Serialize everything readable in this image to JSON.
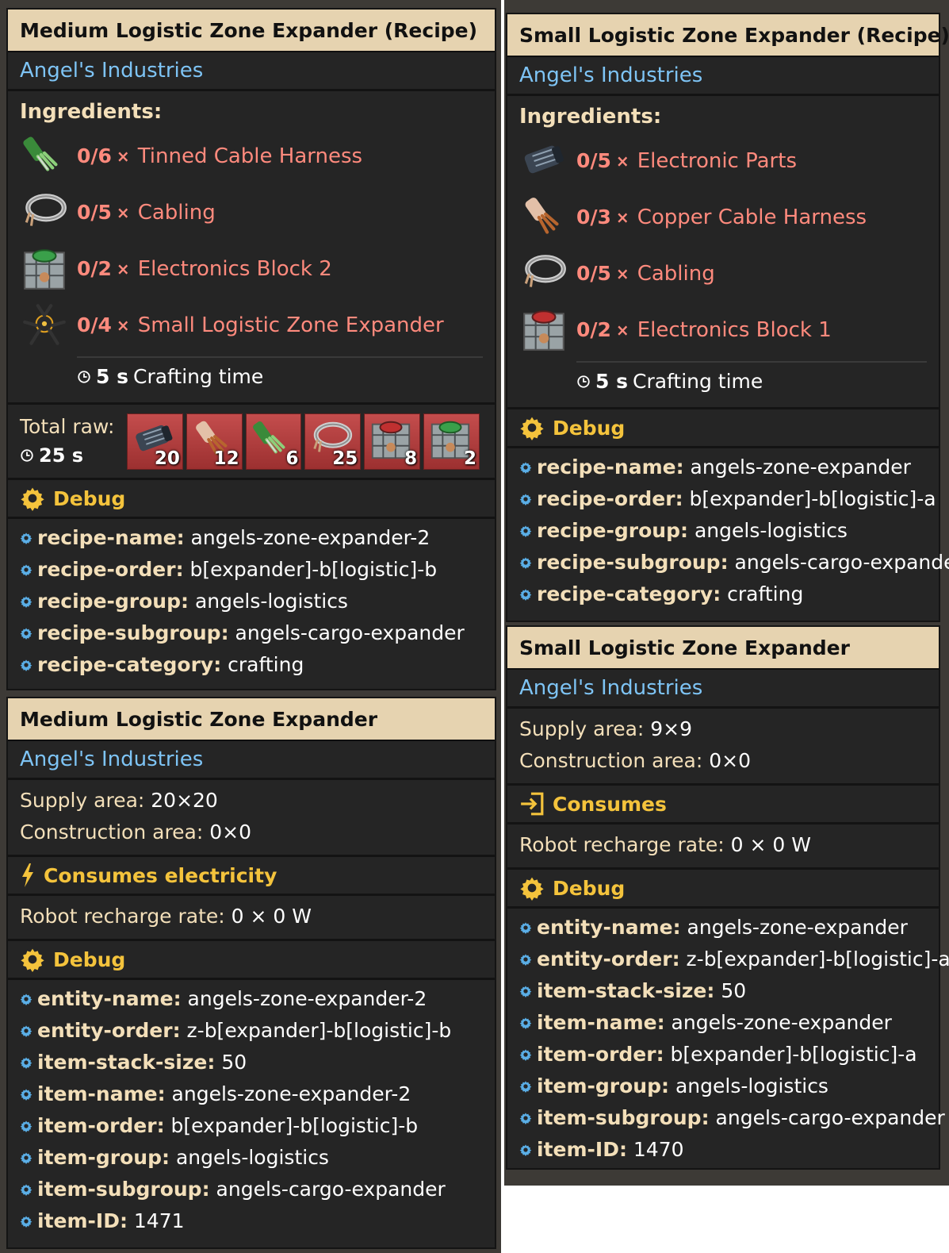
{
  "left": {
    "recipe": {
      "title": "Medium Logistic Zone Expander (Recipe)",
      "mod": "Angel's Industries",
      "ingredients_label": "Ingredients:",
      "ingredients": [
        {
          "count": "0/6",
          "x": "×",
          "name": "Tinned Cable Harness",
          "icon": "tinned-cable-harness-icon"
        },
        {
          "count": "0/5",
          "x": "×",
          "name": "Cabling",
          "icon": "cabling-icon"
        },
        {
          "count": "0/2",
          "x": "×",
          "name": "Electronics Block 2",
          "icon": "electronics-block-2-icon"
        },
        {
          "count": "0/4",
          "x": "×",
          "name": "Small Logistic Zone Expander",
          "icon": "zone-expander-icon"
        }
      ],
      "craft_value": "5 s",
      "craft_label": "Crafting time",
      "total_raw_label": "Total raw:",
      "total_raw_time": "25 s",
      "raw_items": [
        {
          "icon": "electronic-parts-icon",
          "count": "20"
        },
        {
          "icon": "copper-cable-harness-icon",
          "count": "12"
        },
        {
          "icon": "tinned-cable-harness-icon",
          "count": "6"
        },
        {
          "icon": "cabling-icon",
          "count": "25"
        },
        {
          "icon": "electronics-block-1-icon",
          "count": "8"
        },
        {
          "icon": "electronics-block-2-icon",
          "count": "2"
        }
      ],
      "debug_label": "Debug",
      "debug": [
        {
          "k": "recipe-name:",
          "v": "angels-zone-expander-2"
        },
        {
          "k": "recipe-order:",
          "v": "b[expander]-b[logistic]-b"
        },
        {
          "k": "recipe-group:",
          "v": "angels-logistics"
        },
        {
          "k": "recipe-subgroup:",
          "v": "angels-cargo-expander"
        },
        {
          "k": "recipe-category:",
          "v": "crafting"
        }
      ]
    },
    "entity": {
      "title": "Medium Logistic Zone Expander",
      "mod": "Angel's Industries",
      "supply_k": "Supply area:",
      "supply_v": "20×20",
      "construction_k": "Construction area:",
      "construction_v": "0×0",
      "consumes_label": "Consumes electricity",
      "recharge_k": "Robot recharge rate:",
      "recharge_v": "0 × 0 W",
      "debug_label": "Debug",
      "debug": [
        {
          "k": "entity-name:",
          "v": "angels-zone-expander-2"
        },
        {
          "k": "entity-order:",
          "v": "z-b[expander]-b[logistic]-b"
        },
        {
          "k": "item-stack-size:",
          "v": "50"
        },
        {
          "k": "item-name:",
          "v": "angels-zone-expander-2"
        },
        {
          "k": "item-order:",
          "v": "b[expander]-b[logistic]-b"
        },
        {
          "k": "item-group:",
          "v": "angels-logistics"
        },
        {
          "k": "item-subgroup:",
          "v": "angels-cargo-expander"
        },
        {
          "k": "item-ID:",
          "v": "1471"
        }
      ]
    }
  },
  "right": {
    "recipe": {
      "title": "Small Logistic Zone Expander (Recipe)",
      "mod": "Angel's Industries",
      "ingredients_label": "Ingredients:",
      "ingredients": [
        {
          "count": "0/5",
          "x": "×",
          "name": "Electronic Parts",
          "icon": "electronic-parts-icon"
        },
        {
          "count": "0/3",
          "x": "×",
          "name": "Copper Cable Harness",
          "icon": "copper-cable-harness-icon"
        },
        {
          "count": "0/5",
          "x": "×",
          "name": "Cabling",
          "icon": "cabling-icon"
        },
        {
          "count": "0/2",
          "x": "×",
          "name": "Electronics Block 1",
          "icon": "electronics-block-1-icon"
        }
      ],
      "craft_value": "5 s",
      "craft_label": "Crafting time",
      "debug_label": "Debug",
      "debug": [
        {
          "k": "recipe-name:",
          "v": "angels-zone-expander"
        },
        {
          "k": "recipe-order:",
          "v": "b[expander]-b[logistic]-a"
        },
        {
          "k": "recipe-group:",
          "v": "angels-logistics"
        },
        {
          "k": "recipe-subgroup:",
          "v": "angels-cargo-expander"
        },
        {
          "k": "recipe-category:",
          "v": "crafting"
        }
      ]
    },
    "entity": {
      "title": "Small Logistic Zone Expander",
      "mod": "Angel's Industries",
      "supply_k": "Supply area:",
      "supply_v": "9×9",
      "construction_k": "Construction area:",
      "construction_v": "0×0",
      "consumes_label": "Consumes",
      "recharge_k": "Robot recharge rate:",
      "recharge_v": "0 × 0 W",
      "debug_label": "Debug",
      "debug": [
        {
          "k": "entity-name:",
          "v": "angels-zone-expander"
        },
        {
          "k": "entity-order:",
          "v": "z-b[expander]-b[logistic]-a"
        },
        {
          "k": "item-stack-size:",
          "v": "50"
        },
        {
          "k": "item-name:",
          "v": "angels-zone-expander"
        },
        {
          "k": "item-order:",
          "v": "b[expander]-b[logistic]-a"
        },
        {
          "k": "item-group:",
          "v": "angels-logistics"
        },
        {
          "k": "item-subgroup:",
          "v": "angels-cargo-expander"
        },
        {
          "k": "item-ID:",
          "v": "1470"
        }
      ]
    }
  },
  "colors": {
    "title_bg": "#e6d3b0",
    "mod_text": "#7ec4f5",
    "section_head": "#f4c33c",
    "missing": "#ff8a7d",
    "raw_bg": "#b53e3e"
  }
}
